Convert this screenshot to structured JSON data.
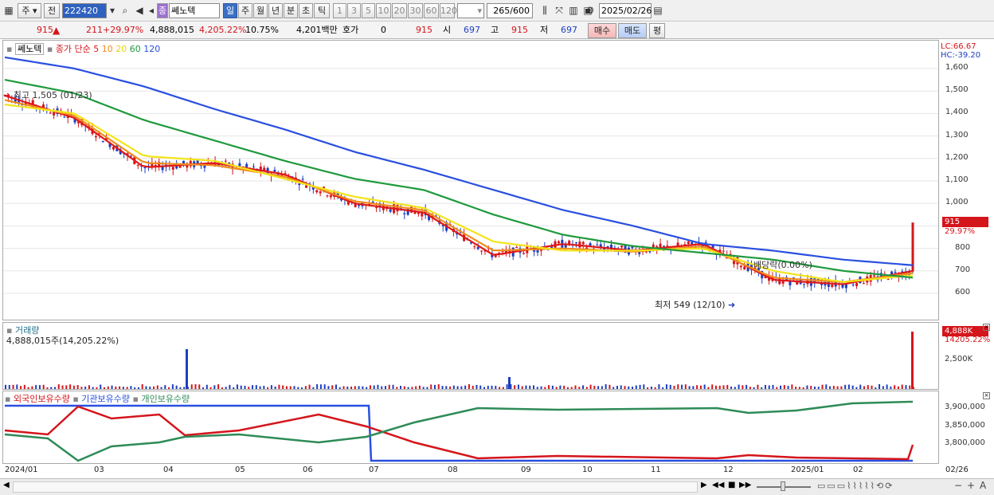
{
  "toolbar": {
    "market": "주",
    "mode": "전",
    "code": "222420",
    "name": "쎄노텍",
    "name_badge": "종",
    "period_tabs": [
      "일",
      "주",
      "월",
      "년",
      "분",
      "초",
      "틱"
    ],
    "interval_buttons": [
      "1",
      "3",
      "5",
      "10",
      "20",
      "30",
      "60",
      "120"
    ],
    "count": "265",
    "count_total": "/600",
    "date": "2025/02/26"
  },
  "quote": {
    "price": "915",
    "change": "211",
    "change_pct": "+29.97%",
    "volume": "4,888,015",
    "volume_ratio": "4,205.22%",
    "turnover_ratio": "10.75%",
    "amount": "4,201백만",
    "hoga_label": "호가",
    "hoga_value": "0",
    "hoga_price": "915",
    "open_label": "시",
    "open": "697",
    "high_label": "고",
    "high": "915",
    "low_label": "저",
    "low": "697",
    "buy": "매수",
    "sell": "매도",
    "eval": "평"
  },
  "price_panel": {
    "stock_tag": "쎄노텍",
    "ma_label": "종가 단순",
    "ma_periods": [
      "5",
      "10",
      "20",
      "60",
      "120"
    ],
    "ma_colors": [
      "#e01818",
      "#f08c1c",
      "#f2e41a",
      "#1e9a3c",
      "#2a4fe0"
    ],
    "lc": "LC:66.67",
    "hc": "HC:-39.20",
    "y_ticks": [
      "1,600",
      "1,500",
      "1,400",
      "1,300",
      "1,200",
      "1,100",
      "1,000",
      "900",
      "800",
      "700",
      "600"
    ],
    "current_price": "915",
    "current_pct": "29.97%",
    "high_annotation": "최고 1,505 (01/23)",
    "low_annotation": "최저 549 (12/10)",
    "dividend_annotation": "배당락(0.00%)"
  },
  "volume_panel": {
    "title": "거래량",
    "value_text": "4,888,015주(14,205.22%)",
    "current": "4,888K",
    "current_pct": "14205.22%",
    "y_ticks": [
      "2,500K"
    ]
  },
  "holding_panel": {
    "series": [
      {
        "name": "외국인보유수량",
        "color": "#d4151b"
      },
      {
        "name": "기관보유수량",
        "color": "#2a4fe0"
      },
      {
        "name": "개인보유수량",
        "color": "#2e8b57"
      }
    ],
    "y_ticks": [
      "3,900,000",
      "3,850,000",
      "3,800,000"
    ]
  },
  "x_axis": {
    "labels": [
      "2024/01",
      "03",
      "04",
      "05",
      "06",
      "07",
      "08",
      "09",
      "10",
      "11",
      "12",
      "2025/01",
      "02"
    ],
    "end_label": "02/26"
  },
  "chart_data": {
    "type": "line",
    "title": "쎄노텍",
    "x": [
      "2024-01",
      "2024-02",
      "2024-03",
      "2024-04",
      "2024-05",
      "2024-06",
      "2024-07",
      "2024-08",
      "2024-09",
      "2024-10",
      "2024-11",
      "2024-12",
      "2025-01",
      "2025-02"
    ],
    "series": [
      {
        "name": "5",
        "values": [
          1480,
          1380,
          1160,
          1180,
          1130,
          1000,
          960,
          770,
          820,
          790,
          820,
          660,
          640,
          700
        ]
      },
      {
        "name": "10",
        "values": [
          1460,
          1390,
          1180,
          1170,
          1120,
          1010,
          970,
          790,
          800,
          785,
          810,
          670,
          650,
          690
        ]
      },
      {
        "name": "20",
        "values": [
          1440,
          1400,
          1210,
          1190,
          1110,
          1030,
          980,
          830,
          790,
          790,
          800,
          700,
          650,
          680
        ]
      },
      {
        "name": "60",
        "values": [
          1550,
          1490,
          1370,
          1280,
          1190,
          1110,
          1060,
          950,
          860,
          810,
          780,
          750,
          700,
          670
        ]
      },
      {
        "name": "120",
        "values": [
          1650,
          1600,
          1520,
          1420,
          1330,
          1230,
          1150,
          1060,
          970,
          900,
          820,
          790,
          750,
          725
        ]
      }
    ],
    "ylim": [
      550,
      1650
    ],
    "last_close": 915,
    "high": {
      "value": 1505,
      "date": "01/23"
    },
    "low": {
      "value": 549,
      "date": "12/10"
    }
  }
}
